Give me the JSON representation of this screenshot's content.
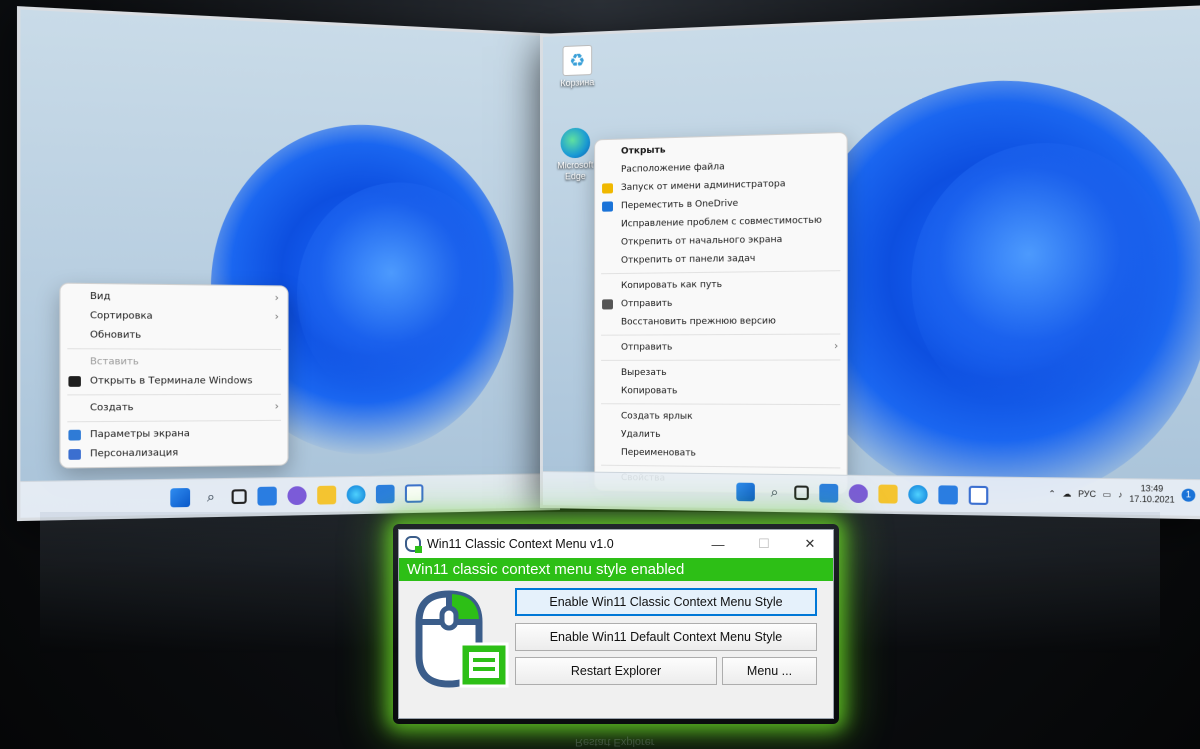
{
  "left_screen": {
    "menu": [
      {
        "label": "Вид",
        "arrow": true
      },
      {
        "label": "Сортировка",
        "arrow": true
      },
      {
        "label": "Обновить"
      },
      {
        "sep": true
      },
      {
        "label": "Вставить",
        "disabled": true
      },
      {
        "label": "Открыть в Терминале Windows",
        "icon": "terminal-icon",
        "color": "#1e1e1e"
      },
      {
        "sep": true
      },
      {
        "label": "Создать",
        "arrow": true
      },
      {
        "sep": true
      },
      {
        "label": "Параметры экрана",
        "icon": "display-settings-icon",
        "color": "#2f7bd6"
      },
      {
        "label": "Персонализация",
        "icon": "personalization-icon",
        "color": "#3b6fd0"
      }
    ]
  },
  "right_screen": {
    "desktop_icons": [
      {
        "label": "Корзина",
        "icon": "recycle-bin-icon"
      },
      {
        "label": "Microsoft Edge",
        "icon": "edge-icon"
      }
    ],
    "menu": [
      {
        "label": "Открыть",
        "bold": true
      },
      {
        "label": "Расположение файла"
      },
      {
        "label": "Запуск от имени администратора",
        "icon": "shield-icon",
        "color": "#f0b800"
      },
      {
        "label": "Переместить в OneDrive",
        "icon": "onedrive-icon",
        "color": "#1a73d8"
      },
      {
        "label": "Исправление проблем с совместимостью"
      },
      {
        "label": "Открепить от начального экрана"
      },
      {
        "label": "Открепить от панели задач"
      },
      {
        "sep": true
      },
      {
        "label": "Копировать как путь"
      },
      {
        "label": "Отправить",
        "icon": "share-icon",
        "color": "#555555"
      },
      {
        "label": "Восстановить прежнюю версию"
      },
      {
        "sep": true
      },
      {
        "label": "Отправить",
        "arrow": true
      },
      {
        "sep": true
      },
      {
        "label": "Вырезать"
      },
      {
        "label": "Копировать"
      },
      {
        "sep": true
      },
      {
        "label": "Создать ярлык"
      },
      {
        "label": "Удалить"
      },
      {
        "label": "Переименовать"
      },
      {
        "sep": true
      },
      {
        "label": "Свойства"
      }
    ],
    "tray": {
      "lang": "РУС",
      "time": "13:49",
      "date": "17.10.2021",
      "badge": "1"
    }
  },
  "app": {
    "title": "Win11 Classic Context Menu v1.0",
    "minimize": "—",
    "maximize": "☐",
    "close": "✕",
    "status": "Win11 classic context menu style enabled",
    "btn_classic": "Enable Win11 Classic Context Menu Style",
    "btn_default": "Enable Win11 Default Context Menu Style",
    "btn_restart": "Restart Explorer",
    "btn_menu": "Menu ...",
    "accent": "#2dbf16"
  }
}
